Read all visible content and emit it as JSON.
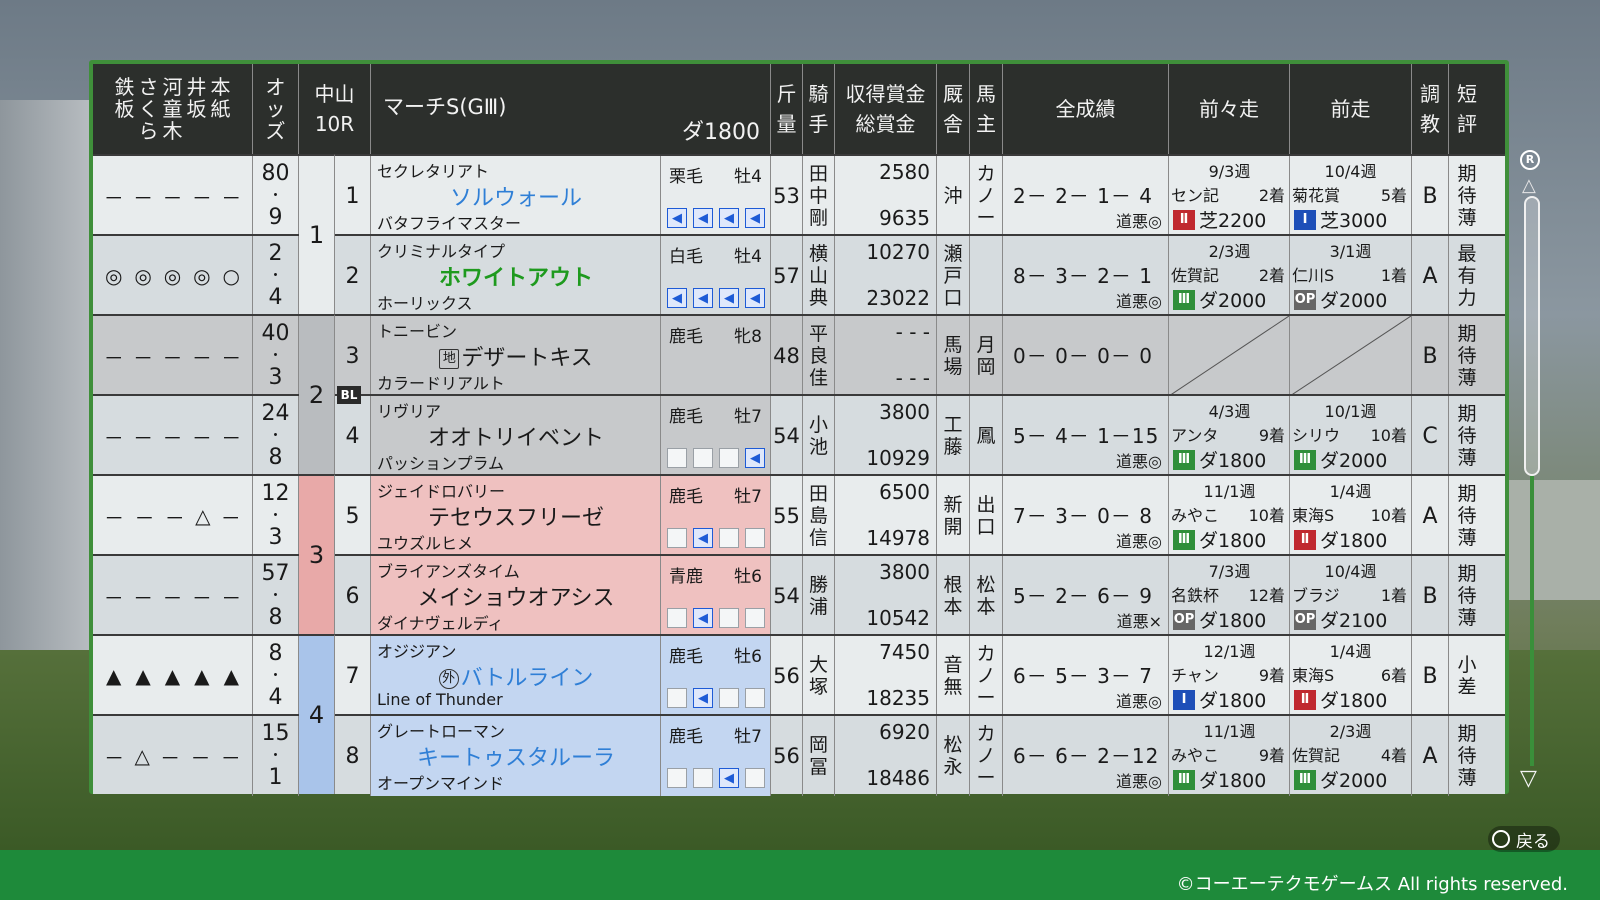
{
  "header": {
    "marks_cols": [
      {
        "chars": [
          "鉄",
          "板"
        ]
      },
      {
        "chars": [
          "さ",
          "く",
          "ら"
        ]
      },
      {
        "chars": [
          "河",
          "童",
          "木"
        ]
      },
      {
        "chars": [
          "井",
          "坂"
        ]
      },
      {
        "chars": [
          "本",
          "紙"
        ]
      }
    ],
    "odds": "オッズ",
    "track": "中山",
    "race_no": "10R",
    "race_title": "マーチS(GⅢ)",
    "distance": "ダ1800",
    "weight_top": "斤",
    "weight_bottom": "量",
    "jockey_top": "騎",
    "jockey_bottom": "手",
    "prize_top": "収得賞金",
    "prize_bottom": "総賞金",
    "stable_top": "厩",
    "stable_bottom": "舎",
    "owner_top": "馬",
    "owner_bottom": "主",
    "record": "全成績",
    "prev2": "前々走",
    "prev1": "前走",
    "train_top": "調",
    "train_bottom": "教",
    "short_top": "短",
    "short_bottom": "評"
  },
  "gates": [
    {
      "no": "1",
      "color": "#e8eced"
    },
    {
      "no": "2",
      "color": "#b9bcbf"
    },
    {
      "no": "3",
      "color": "#e8a9a8"
    },
    {
      "no": "4",
      "color": "#a9c4ea"
    }
  ],
  "horses": [
    {
      "marks": [
        "－",
        "－",
        "－",
        "－",
        "－"
      ],
      "odds_int": "80",
      "odds_dec": "9",
      "num": "1",
      "sire": "セクレタリアト",
      "name": "ソルウォール",
      "name_color": "#2f7fd6",
      "prefix": "",
      "dam": "バタフライマスター",
      "coat": "栗毛",
      "sex": "牡4",
      "arrows": [
        true,
        true,
        true,
        true
      ],
      "weight": "53",
      "jockey": "田中剛",
      "prize": "2580",
      "total": "9635",
      "stable": "沖",
      "owner": "カノー",
      "record": "2－ 2－ 1－ 4",
      "cond": "道悪◎",
      "p2_week": "9/3週",
      "p2_race": "セン記",
      "p2_place": "2着",
      "p2_grade": "Ⅱ",
      "p2_gc": "g-red",
      "p2_course": "芝2200",
      "p1_week": "10/4週",
      "p1_race": "菊花賞",
      "p1_place": "5着",
      "p1_grade": "Ⅰ",
      "p1_gc": "g-blue",
      "p1_course": "芝3000",
      "train": "B",
      "short": "期待薄",
      "bg": "#e8eced"
    },
    {
      "marks": [
        "◎",
        "◎",
        "◎",
        "◎",
        "○"
      ],
      "odds_int": "2",
      "odds_dec": "4",
      "num": "2",
      "sire": "クリミナルタイプ",
      "name": "ホワイトアウト",
      "name_color": "#1e9a1e",
      "prefix": "",
      "dam": "ホーリックス",
      "coat": "白毛",
      "sex": "牡4",
      "arrows": [
        true,
        true,
        true,
        true
      ],
      "weight": "57",
      "jockey": "横山典",
      "prize": "10270",
      "total": "23022",
      "stable": "瀬戸口",
      "owner": "",
      "record": "8－ 3－ 2－ 1",
      "cond": "道悪◎",
      "p2_week": "2/3週",
      "p2_race": "佐賀記",
      "p2_place": "2着",
      "p2_grade": "Ⅲ",
      "p2_gc": "g-green",
      "p2_course": "ダ2000",
      "p1_week": "3/1週",
      "p1_race": "仁川S",
      "p1_place": "1着",
      "p1_grade": "OP",
      "p1_gc": "g-gray",
      "p1_course": "ダ2000",
      "train": "A",
      "short": "最有力",
      "bg": "#d6dcdf"
    },
    {
      "marks": [
        "－",
        "－",
        "－",
        "－",
        "－"
      ],
      "odds_int": "40",
      "odds_dec": "3",
      "num": "3",
      "sire": "トニービン",
      "name": "デザートキス",
      "name_color": "#1a1a1a",
      "prefix": "地",
      "dam": "カラードリアルト",
      "coat": "鹿毛",
      "sex": "牝8",
      "arrows": [],
      "weight": "48",
      "jockey": "平良佳",
      "prize": "- - -",
      "total": "- - -",
      "stable": "馬場",
      "owner": "月岡",
      "record": "0－ 0－ 0－ 0",
      "cond": "",
      "p2_week": "",
      "p2_race": "",
      "p2_place": "",
      "p2_grade": "",
      "p2_gc": "",
      "p2_course": "",
      "p1_week": "",
      "p1_race": "",
      "p1_place": "",
      "p1_grade": "",
      "p1_gc": "",
      "p1_course": "",
      "train": "B",
      "short": "期待薄",
      "bg": "#c7c9cb"
    },
    {
      "marks": [
        "－",
        "－",
        "－",
        "－",
        "－"
      ],
      "odds_int": "24",
      "odds_dec": "8",
      "num": "4",
      "sire": "リヴリア",
      "name": "オオトリイベント",
      "name_color": "#1a1a1a",
      "prefix": "",
      "dam": "パッションプラム",
      "coat": "鹿毛",
      "sex": "牡7",
      "arrows": [
        false,
        false,
        false,
        true
      ],
      "weight": "54",
      "jockey": "小池",
      "prize": "3800",
      "total": "10929",
      "stable": "工藤",
      "owner": "鳳",
      "record": "5－ 4－ 1－15",
      "cond": "道悪◎",
      "p2_week": "4/3週",
      "p2_race": "アンタ",
      "p2_place": "9着",
      "p2_grade": "Ⅲ",
      "p2_gc": "g-green",
      "p2_course": "ダ1800",
      "p1_week": "10/1週",
      "p1_race": "シリウ",
      "p1_place": "10着",
      "p1_grade": "Ⅲ",
      "p1_gc": "g-green",
      "p1_course": "ダ2000",
      "train": "C",
      "short": "期待薄",
      "bg": "#d6dcdf"
    },
    {
      "marks": [
        "－",
        "－",
        "－",
        "△",
        "－"
      ],
      "odds_int": "12",
      "odds_dec": "3",
      "num": "5",
      "sire": "ジェイドロバリー",
      "name": "テセウスフリーゼ",
      "name_color": "#1a1a1a",
      "prefix": "",
      "dam": "ユウズルヒメ",
      "coat": "鹿毛",
      "sex": "牡7",
      "arrows": [
        false,
        true,
        false,
        false
      ],
      "weight": "55",
      "jockey": "田島信",
      "prize": "6500",
      "total": "14978",
      "stable": "新開",
      "owner": "出口",
      "record": "7－ 3－ 0－ 8",
      "cond": "道悪◎",
      "p2_week": "11/1週",
      "p2_race": "みやこ",
      "p2_place": "10着",
      "p2_grade": "Ⅲ",
      "p2_gc": "g-green",
      "p2_course": "ダ1800",
      "p1_week": "1/4週",
      "p1_race": "東海S",
      "p1_place": "10着",
      "p1_grade": "Ⅱ",
      "p1_gc": "g-red",
      "p1_course": "ダ1800",
      "train": "A",
      "short": "期待薄",
      "bg": "#e8eced"
    },
    {
      "marks": [
        "－",
        "－",
        "－",
        "－",
        "－"
      ],
      "odds_int": "57",
      "odds_dec": "8",
      "num": "6",
      "sire": "ブライアンズタイム",
      "name": "メイショウオアシス",
      "name_color": "#1a1a1a",
      "prefix": "",
      "dam": "ダイナヴェルディ",
      "coat": "青鹿",
      "sex": "牡6",
      "arrows": [
        false,
        true,
        false,
        false
      ],
      "weight": "54",
      "jockey": "勝浦",
      "prize": "3800",
      "total": "10542",
      "stable": "根本",
      "owner": "松本",
      "record": "5－ 2－ 6－ 9",
      "cond": "道悪×",
      "p2_week": "7/3週",
      "p2_race": "名鉄杯",
      "p2_place": "12着",
      "p2_grade": "OP",
      "p2_gc": "g-gray",
      "p2_course": "ダ1800",
      "p1_week": "10/4週",
      "p1_race": "ブラジ",
      "p1_place": "1着",
      "p1_grade": "OP",
      "p1_gc": "g-gray",
      "p1_course": "ダ2100",
      "train": "B",
      "short": "期待薄",
      "bg": "#d6dcdf"
    },
    {
      "marks": [
        "▲",
        "▲",
        "▲",
        "▲",
        "▲"
      ],
      "odds_int": "8",
      "odds_dec": "4",
      "num": "7",
      "sire": "オジジアン",
      "name": "バトルライン",
      "name_color": "#2f7fd6",
      "prefix": "外",
      "dam": "Line of Thunder",
      "coat": "鹿毛",
      "sex": "牡6",
      "arrows": [
        false,
        true,
        false,
        false
      ],
      "weight": "56",
      "jockey": "大塚",
      "prize": "7450",
      "total": "18235",
      "stable": "音無",
      "owner": "カノー",
      "record": "6－ 5－ 3－ 7",
      "cond": "道悪◎",
      "p2_week": "12/1週",
      "p2_race": "チャン",
      "p2_place": "9着",
      "p2_grade": "Ⅰ",
      "p2_gc": "g-blue",
      "p2_course": "ダ1800",
      "p1_week": "1/4週",
      "p1_race": "東海S",
      "p1_place": "6着",
      "p1_grade": "Ⅱ",
      "p1_gc": "g-red",
      "p1_course": "ダ1800",
      "train": "B",
      "short": "小差",
      "bg": "#e8eced"
    },
    {
      "marks": [
        "－",
        "△",
        "－",
        "－",
        "－"
      ],
      "odds_int": "15",
      "odds_dec": "1",
      "num": "8",
      "sire": "グレートローマン",
      "name": "キートゥスタルーラ",
      "name_color": "#2f7fd6",
      "prefix": "",
      "dam": "オープンマインド",
      "coat": "鹿毛",
      "sex": "牡7",
      "arrows": [
        false,
        false,
        true,
        false
      ],
      "weight": "56",
      "jockey": "岡冨",
      "prize": "6920",
      "total": "18486",
      "stable": "松永",
      "owner": "カノー",
      "record": "6－ 6－ 2－12",
      "cond": "道悪◎",
      "p2_week": "11/1週",
      "p2_race": "みやこ",
      "p2_place": "9着",
      "p2_grade": "Ⅲ",
      "p2_gc": "g-green",
      "p2_course": "ダ1800",
      "p1_week": "2/3週",
      "p1_race": "佐賀記",
      "p1_place": "4着",
      "p1_grade": "Ⅲ",
      "p1_gc": "g-green",
      "p1_course": "ダ2000",
      "train": "A",
      "short": "期待薄",
      "bg": "#d6dcdf"
    }
  ],
  "bl_badge": "BL",
  "r_button": "R",
  "back_label": "戻る",
  "copyright": "©コーエーテクモゲームス All rights reserved."
}
